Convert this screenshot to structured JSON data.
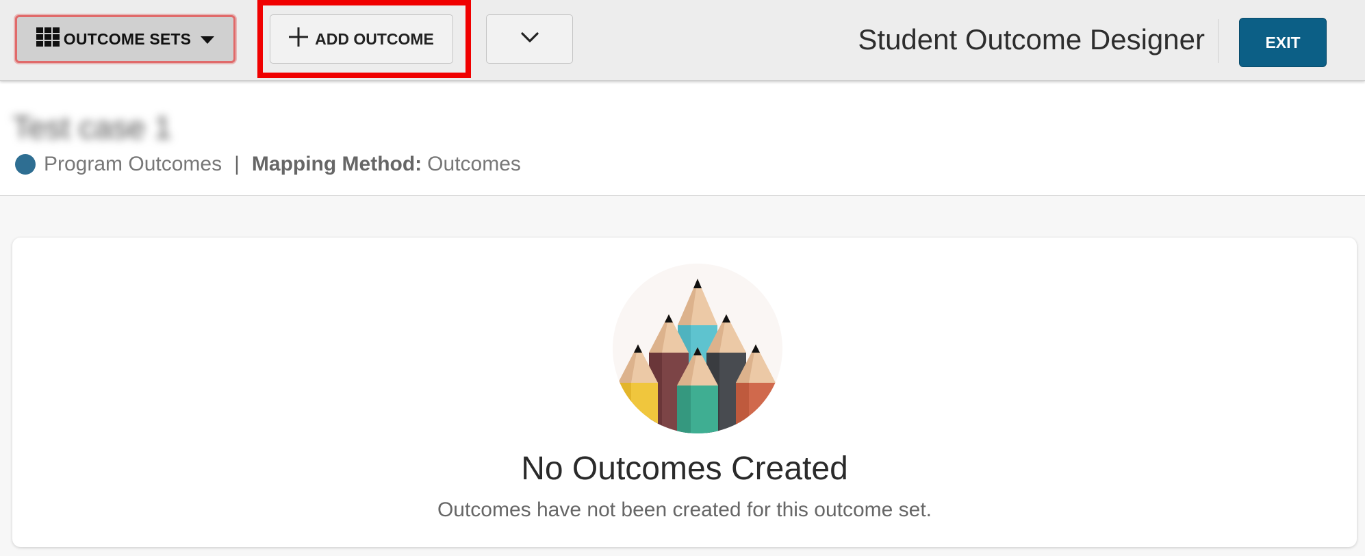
{
  "toolbar": {
    "outcome_sets_label": "OUTCOME SETS",
    "add_outcome_label": "ADD OUTCOME",
    "app_title": "Student Outcome Designer",
    "exit_label": "EXIT"
  },
  "header": {
    "set_name": "Test case 1",
    "set_type": "Program Outcomes",
    "separator": "|",
    "mapping_label": "Mapping Method:",
    "mapping_value": "Outcomes"
  },
  "empty_state": {
    "title": "No Outcomes Created",
    "subtitle": "Outcomes have not been created for this outcome set."
  },
  "icons": {
    "outcome_sets": "grid-icon",
    "outcome_sets_caret": "caret-down-icon",
    "add": "plus-icon",
    "more": "chevron-down-icon",
    "set_type": "dot-icon"
  },
  "colors": {
    "exit_button": "#0c5f86",
    "set_type_dot": "#2e6e92",
    "highlight": "#f00000"
  }
}
